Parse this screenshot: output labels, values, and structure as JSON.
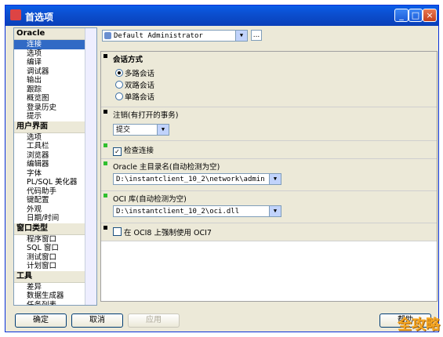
{
  "window": {
    "title": "首选项"
  },
  "tree": {
    "groups": [
      {
        "label": "Oracle",
        "items": [
          "连接",
          "选项",
          "编译",
          "调试器",
          "输出",
          "跟踪",
          "概览图",
          "登录历史",
          "提示"
        ]
      },
      {
        "label": "用户界面",
        "items": [
          "选项",
          "工具栏",
          "浏览器",
          "编辑器",
          "字体",
          "PL/SQL 美化器",
          "代码助手",
          "键配置",
          "外观",
          "日期/时间"
        ]
      },
      {
        "label": "窗口类型",
        "items": [
          "程序窗口",
          "SQL 窗口",
          "测试窗口",
          "计划窗口"
        ]
      },
      {
        "label": "工具",
        "items": [
          "差异",
          "数据生成器",
          "任务列表"
        ]
      }
    ],
    "selected": "连接"
  },
  "profile": {
    "value": "Default Administrator",
    "more_label": "..."
  },
  "sections": {
    "session_mode": {
      "title": "会话方式",
      "options": [
        "多路会话",
        "双路会话",
        "单路会话"
      ],
      "selected": "多路会话"
    },
    "logoff": {
      "title": "注销(有打开的事务)",
      "value": "提交"
    },
    "check_conn": {
      "label": "检查连接",
      "checked": true
    },
    "oracle_home": {
      "title": "Oracle 主目录名(自动检测为空)",
      "value": "D:\\instantclient_10_2\\network\\admin"
    },
    "oci_lib": {
      "title": "OCI 库(自动检测为空)",
      "value": "D:\\instantclient_10_2\\oci.dll"
    },
    "force_oci7": {
      "label": "在 OCI8 上强制使用 OCI7",
      "checked": false
    }
  },
  "buttons": {
    "ok": "确定",
    "cancel": "取消",
    "apply": "应用",
    "help": "帮助"
  },
  "watermark": "全攻略",
  "colors": {
    "titlebar": "#0a5ee8",
    "selection": "#316ac5",
    "green_marker": "#2fbf2f"
  }
}
